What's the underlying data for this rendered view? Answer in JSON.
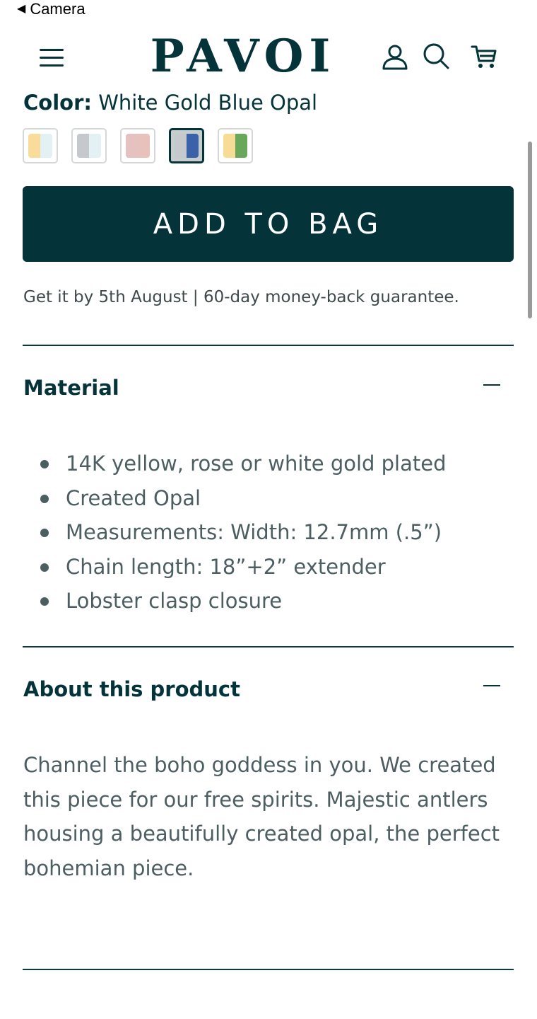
{
  "status_bar": {
    "back_app": "Camera"
  },
  "header": {
    "logo": "PAVOI",
    "icons": [
      "menu-icon",
      "account-icon",
      "search-icon",
      "cart-icon"
    ]
  },
  "product": {
    "color_label": "Color:",
    "color_value": "White Gold Blue Opal",
    "swatches": [
      {
        "name": "Yellow Gold White Opal",
        "colors": [
          "#f9dc9a",
          "#e3f1f5"
        ],
        "selected": false
      },
      {
        "name": "White Gold White Opal",
        "colors": [
          "#c5c9ce",
          "#e3f1f5"
        ],
        "selected": false
      },
      {
        "name": "Rose Gold Pink Opal",
        "colors": [
          "#e5c2bf",
          "#e8c1bd"
        ],
        "selected": false
      },
      {
        "name": "White Gold Blue Opal",
        "colors": [
          "#c5c9ce",
          "#3b62a8"
        ],
        "selected": true
      },
      {
        "name": "Yellow Gold Green Opal",
        "colors": [
          "#f7dc96",
          "#69a75a"
        ],
        "selected": false
      }
    ],
    "add_to_bag": "ADD TO BAG",
    "delivery": "Get it by 5th August | 60-day money-back guarantee."
  },
  "material": {
    "title": "Material",
    "items": [
      "14K yellow, rose or white gold plated",
      "Created Opal",
      "Measurements: Width: 12.7mm (.5”)",
      "Chain length: 18”+2” extender",
      "Lobster clasp closure"
    ]
  },
  "about": {
    "title": "About this product",
    "text": "Channel the boho goddess in you. We created this piece for our free spirits. Majestic antlers housing a beautifully created opal, the perfect bohemian piece."
  },
  "colors": {
    "brand": "#04333a",
    "body_text": "#4c5e62"
  }
}
